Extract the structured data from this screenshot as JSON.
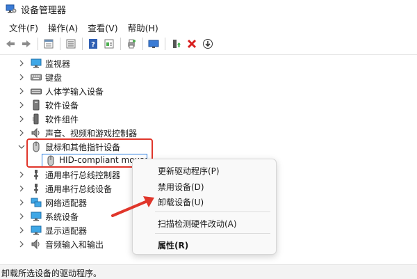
{
  "window": {
    "title": "设备管理器",
    "app_icon": "device-manager-icon"
  },
  "menu": {
    "items": [
      {
        "label": "文件(F)"
      },
      {
        "label": "操作(A)"
      },
      {
        "label": "查看(V)"
      },
      {
        "label": "帮助(H)"
      }
    ]
  },
  "toolbar": {
    "buttons": [
      "back-icon",
      "forward-icon",
      "properties-icon",
      "list-icon",
      "help-icon",
      "view-icon",
      "print-icon",
      "monitor-icon",
      "update-driver-icon",
      "uninstall-icon",
      "download-icon"
    ]
  },
  "tree": {
    "items": [
      {
        "label": "监视器",
        "icon": "monitor-icon"
      },
      {
        "label": "键盘",
        "icon": "keyboard-icon"
      },
      {
        "label": "人体学输入设备",
        "icon": "hid-icon"
      },
      {
        "label": "软件设备",
        "icon": "software-device-icon"
      },
      {
        "label": "软件组件",
        "icon": "software-component-icon"
      },
      {
        "label": "声音、视频和游戏控制器",
        "icon": "sound-icon"
      },
      {
        "label": "鼠标和其他指针设备",
        "icon": "mouse-icon",
        "expanded": true
      },
      {
        "label": "通用串行总线控制器",
        "icon": "usb-icon"
      },
      {
        "label": "通用串行总线设备",
        "icon": "usb-icon"
      },
      {
        "label": "网络适配器",
        "icon": "network-icon"
      },
      {
        "label": "系统设备",
        "icon": "system-device-icon"
      },
      {
        "label": "显示适配器",
        "icon": "display-adapter-icon"
      },
      {
        "label": "音频输入和输出",
        "icon": "audio-icon"
      }
    ],
    "selected_child": {
      "label": "HID-compliant mouse",
      "icon": "mouse-icon"
    }
  },
  "context_menu": {
    "items": [
      {
        "label": "更新驱动程序(P)"
      },
      {
        "label": "禁用设备(D)"
      },
      {
        "label": "卸载设备(U)"
      },
      {
        "label": "扫描检测硬件改动(A)"
      },
      {
        "label": "属性(R)"
      }
    ]
  },
  "status": {
    "text": "卸载所选设备的驱动程序。"
  },
  "colors": {
    "highlight": "#e0362b",
    "selection_border": "#2b7de0"
  }
}
